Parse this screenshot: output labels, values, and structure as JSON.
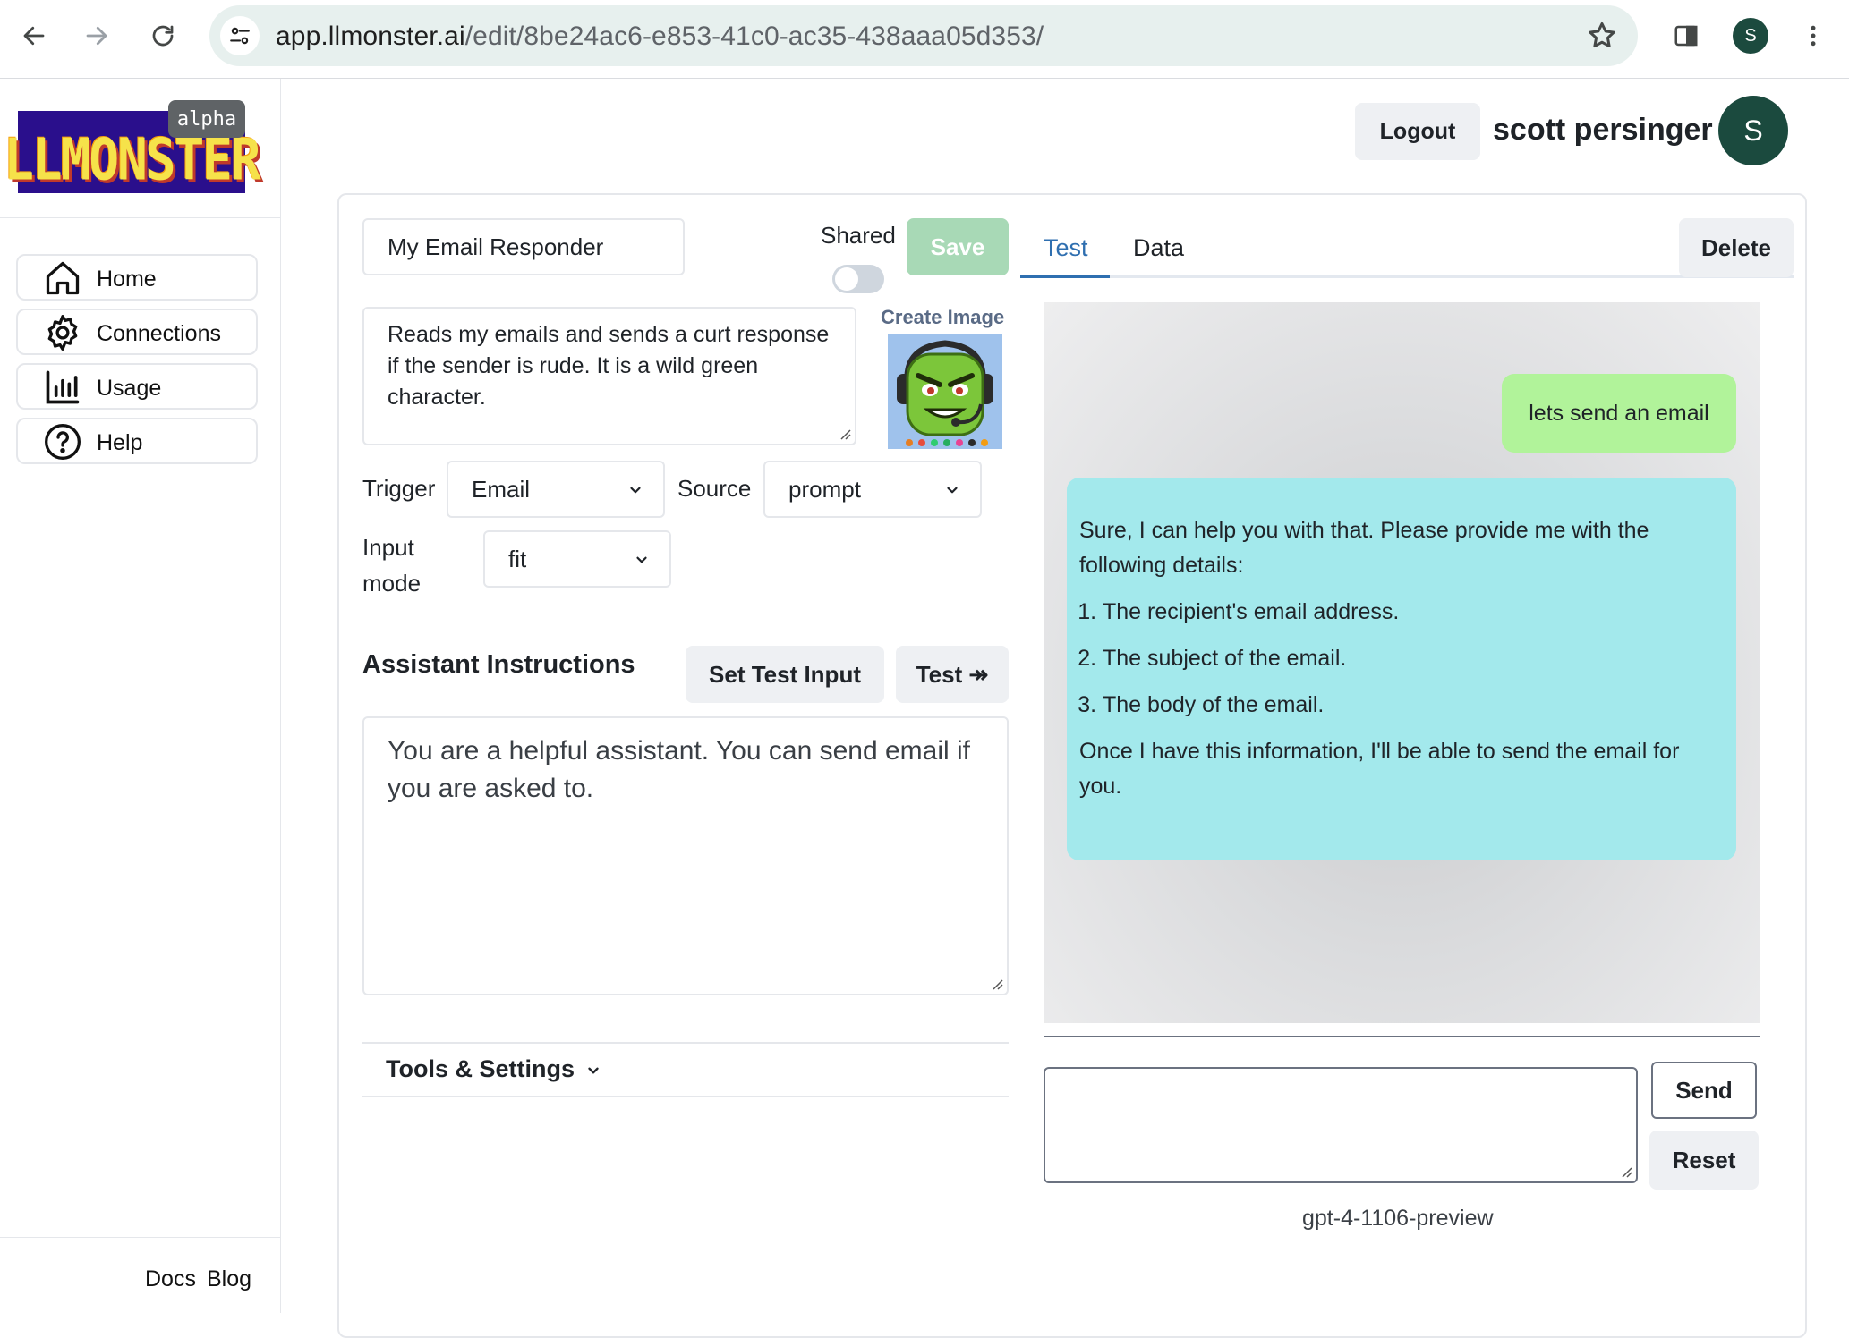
{
  "browser": {
    "url_host": "app.llmonster.ai",
    "url_path": "/edit/8be24ac6-e853-41c0-ac35-438aaa05d353/",
    "profile_initial": "S"
  },
  "sidebar": {
    "logo_text": "LLMONSTER",
    "badge": "alpha",
    "items": [
      {
        "label": "Home",
        "icon": "home-icon"
      },
      {
        "label": "Connections",
        "icon": "gear-icon"
      },
      {
        "label": "Usage",
        "icon": "bar-chart-icon"
      },
      {
        "label": "Help",
        "icon": "help-icon"
      }
    ],
    "footer": {
      "docs": "Docs",
      "blog": "Blog"
    }
  },
  "header": {
    "logout_label": "Logout",
    "username": "scott persinger",
    "avatar_initial": "S"
  },
  "editor": {
    "name_value": "My Email Responder",
    "shared_label": "Shared",
    "shared_on": false,
    "save_label": "Save",
    "description": "Reads my emails and sends a curt response if the sender is rude. It is a wild green character.",
    "create_image_label": "Create Image",
    "trigger_label": "Trigger",
    "trigger_value": "Email",
    "source_label": "Source",
    "source_value": "prompt",
    "input_mode_label_1": "Input",
    "input_mode_label_2": "mode",
    "input_mode_value": "fit",
    "instructions_title": "Assistant Instructions",
    "set_test_input_label": "Set Test Input",
    "test_label": "Test ↠",
    "instructions_text": "You are a helpful assistant. You can send email if you are asked to.",
    "tools_label": "Tools & Settings"
  },
  "panel": {
    "tabs": [
      {
        "label": "Test",
        "active": true
      },
      {
        "label": "Data",
        "active": false
      }
    ],
    "delete_label": "Delete",
    "messages": {
      "user": "lets send an email",
      "bot_intro": "Sure, I can help you with that. Please provide me with the following details:",
      "bot_list": [
        "The recipient's email address.",
        "The subject of the email.",
        "The body of the email."
      ],
      "bot_outro": "Once I have this information, I'll be able to send the email for you."
    },
    "message_placeholder": "",
    "send_label": "Send",
    "reset_label": "Reset",
    "model": "gpt-4-1106-preview"
  },
  "colors": {
    "accent": "#2f6fb0",
    "user_bubble": "#b1f39a",
    "bot_bubble": "#a3e9ec",
    "save_disabled": "#a8d9b6",
    "avatar": "#1b4a3e"
  }
}
